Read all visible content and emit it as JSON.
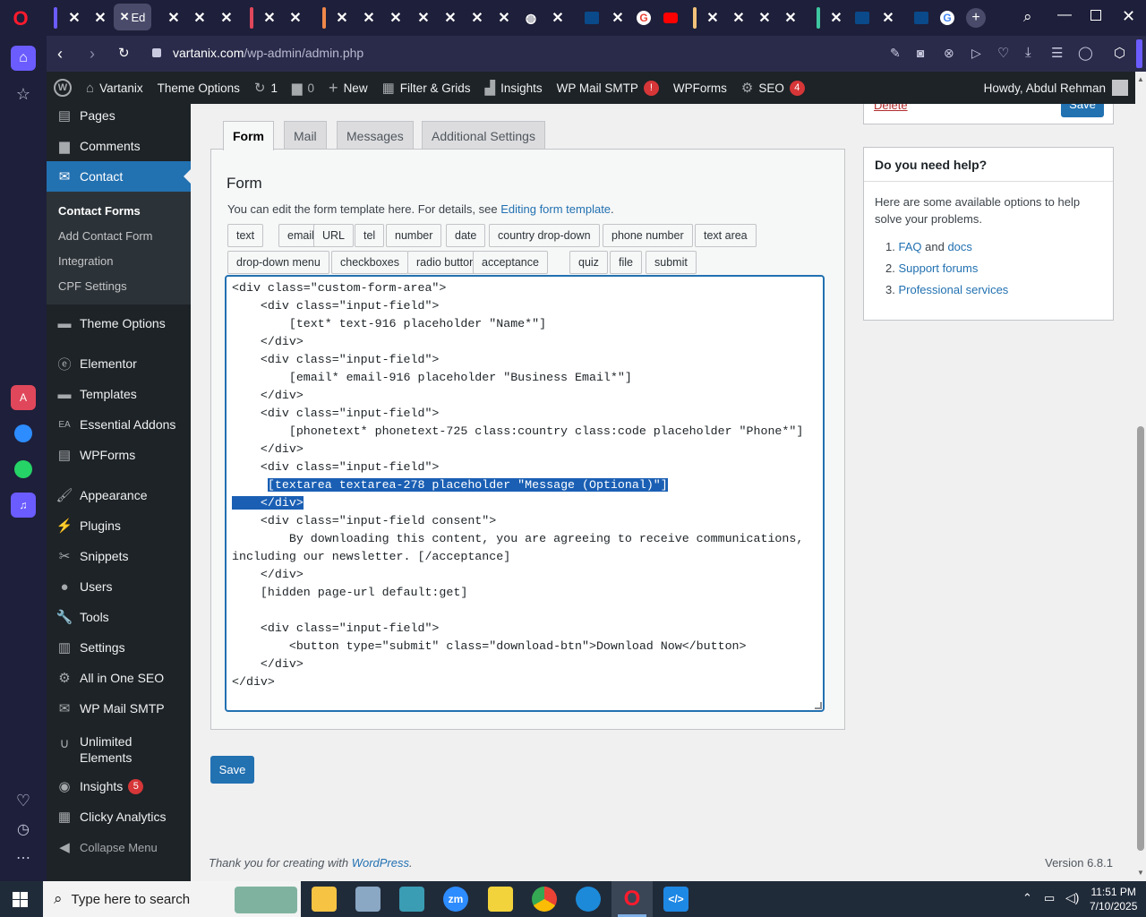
{
  "browser": {
    "url_domain": "vartanix.com",
    "url_path": "/wp-admin/admin.php",
    "active_tab_label": "Ed"
  },
  "wp_bar": {
    "site_name": "Vartanix",
    "theme_options": "Theme Options",
    "updates_count": "1",
    "comments_count": "0",
    "new_label": "New",
    "filter_grids": "Filter & Grids",
    "insights": "Insights",
    "wp_mail_smtp": "WP Mail SMTP",
    "wp_mail_smtp_badge": "!",
    "wpforms": "WPForms",
    "seo": "SEO",
    "seo_badge": "4",
    "howdy": "Howdy, Abdul Rehman"
  },
  "menu": {
    "pages": "Pages",
    "comments": "Comments",
    "contact": "Contact",
    "contact_sub": [
      "Contact Forms",
      "Add Contact Form",
      "Integration",
      "CPF Settings"
    ],
    "theme_options": "Theme Options",
    "elementor": "Elementor",
    "templates": "Templates",
    "essential_addons": "Essential Addons",
    "wpforms": "WPForms",
    "appearance": "Appearance",
    "plugins": "Plugins",
    "snippets": "Snippets",
    "users": "Users",
    "tools": "Tools",
    "settings": "Settings",
    "aioseo": "All in One SEO",
    "wp_mail_smtp": "WP Mail SMTP",
    "unlimited_1": "Unlimited",
    "unlimited_2": "Elements",
    "insights": "Insights",
    "insights_badge": "5",
    "clicky": "Clicky Analytics",
    "collapse": "Collapse Menu"
  },
  "tabs": [
    "Form",
    "Mail",
    "Messages",
    "Additional Settings"
  ],
  "form_panel": {
    "heading": "Form",
    "desc_prefix": "You can edit the form template here. For details, see ",
    "desc_link": "Editing form template",
    "desc_suffix": ".",
    "tag_row1": [
      "text",
      "email",
      "URL",
      "tel",
      "number",
      "date",
      "country drop-down",
      "phone number",
      "text area"
    ],
    "tag_row2": [
      "drop-down menu",
      "checkboxes",
      "radio buttons",
      "acceptance",
      "quiz",
      "file",
      "submit"
    ]
  },
  "code_lines": [
    "<div class=\"custom-form-area\">",
    "    <div class=\"input-field\">",
    "        [text* text-916 placeholder \"Name*\"]",
    "    </div>",
    "    <div class=\"input-field\">",
    "        [email* email-916 placeholder \"Business Email*\"]",
    "    </div>",
    "    <div class=\"input-field\">",
    "        [phonetext* phonetext-725 class:country class:code placeholder \"Phone*\"]",
    "    </div>",
    "    <div class=\"input-field\">",
    "        [textarea textarea-278 placeholder \"Message (Optional)\"]",
    "    </div>",
    "    <div class=\"input-field consent\">",
    "        By downloading this content, you are agreeing to receive communications,",
    "including our newsletter. [/acceptance]",
    "    </div>",
    "    [hidden page-url default:get]",
    "",
    "    <div class=\"input-field\">",
    "        <button type=\"submit\" class=\"download-btn\">Download Now</button>",
    "    </div>",
    "</div>"
  ],
  "save_label": "Save",
  "top_partial": {
    "delete": "Delete",
    "save": "Save"
  },
  "help": {
    "title": "Do you need help?",
    "desc": "Here are some available options to help solve your problems.",
    "item1_num": "1.",
    "item1_a": "FAQ",
    "item1_and": "and",
    "item1_b": "docs",
    "item2_num": "2.",
    "item2": "Support forums",
    "item3_num": "3.",
    "item3": "Professional services"
  },
  "footer": {
    "thanks_prefix": "Thank you for creating with ",
    "thanks_link": "WordPress",
    "thanks_suffix": ".",
    "version": "Version 6.8.1"
  },
  "taskbar": {
    "search_placeholder": "Type here to search",
    "time": "11:51 PM",
    "date": "7/10/2025"
  },
  "colors": {
    "wp_blue": "#2271b1",
    "wp_dark": "#1d2327",
    "opera_red": "#ff1b2d",
    "badge_red": "#d63638"
  }
}
